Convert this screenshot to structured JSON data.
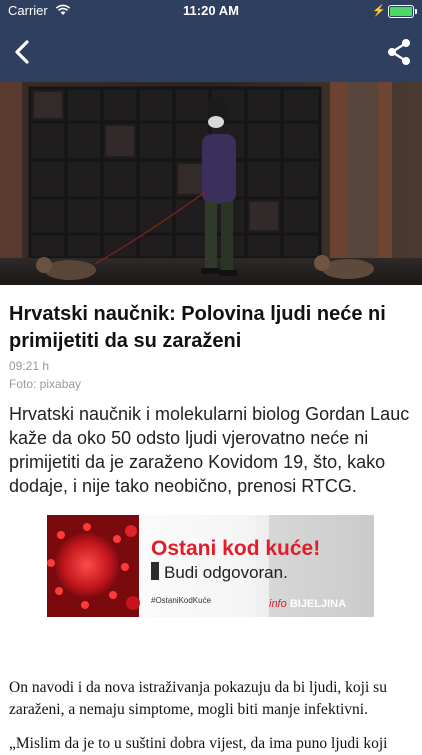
{
  "status_bar": {
    "carrier": "Carrier",
    "time": "11:20 AM"
  },
  "nav": {
    "back_icon": "chevron-left-icon",
    "share_icon": "share-icon"
  },
  "colors": {
    "nav_background": "#2f3f5f",
    "battery_green": "#4cd964",
    "banner_red": "#e11d2b"
  },
  "article": {
    "title": "Hrvatski naučnik: Polovina ljudi neće ni primijetiti da su zaraženi",
    "time": "09:21 h",
    "photo_credit": "Foto: pixabay",
    "lead": "Hrvatski naučnik i molekularni biolog Gordan Lauc kaže da oko 50 odsto ljudi vjerovatno neće ni primijetiti da je zaraženo Kovidom 19, što, kako dodaje, i nije tako neobično, prenosi RTCG.",
    "paragraph_1": "On navodi i da nova istraživanja pokazuju da bi ljudi, koji su zaraženi, a nemaju simptome, mogli biti manje infektivni.",
    "paragraph_2": "„Mislim da je to u suštini dobra vijest, da ima puno ljudi koji"
  },
  "banner": {
    "headline": "Ostani kod kuće!",
    "subline": "Budi odgovoran.",
    "hashtag": "#OstaniKodKuće",
    "brand_prefix": "info",
    "brand_name": "BIJELJINA"
  }
}
